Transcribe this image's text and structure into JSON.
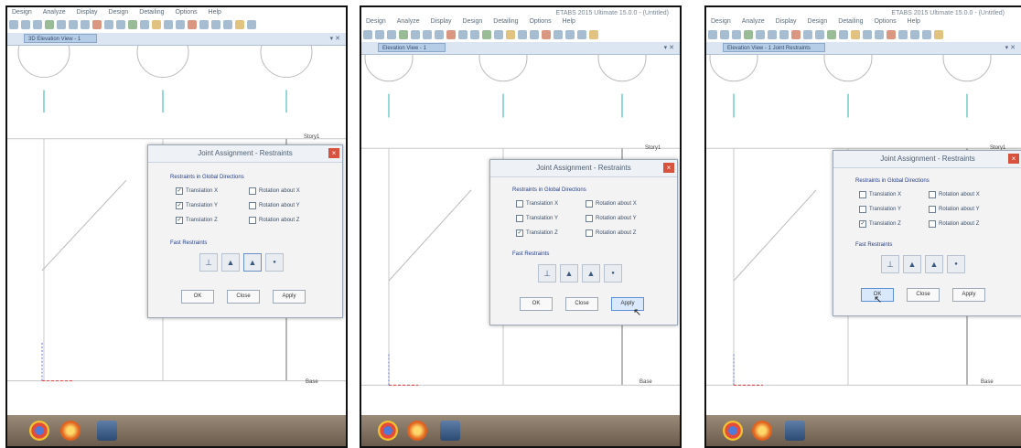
{
  "app": {
    "window_title": "ETABS 2015 Ultimate 15.0.0 - (Untitled)",
    "menu": [
      "Design",
      "Analyze",
      "Display",
      "Design",
      "Detailing",
      "Options",
      "Help"
    ],
    "tab_label_1": "3D Elevation View - 1",
    "tab_label_2": "Elevation View - 1",
    "tab_label_3": "Elevation View - 1 Joint Restraints",
    "story_top": "Story1",
    "story_base": "Base"
  },
  "dialog": {
    "title": "Joint Assignment - Restraints",
    "close_glyph": "×",
    "group_global": "Restraints in Global Directions",
    "group_fast": "Fast Restraints",
    "labels": {
      "ux": "Translation X",
      "uy": "Translation Y",
      "uz": "Translation Z",
      "rx": "Rotation about X",
      "ry": "Rotation about Y",
      "rz": "Rotation about Z"
    },
    "buttons": {
      "ok": "OK",
      "close": "Close",
      "apply": "Apply"
    },
    "fast_icons": {
      "none": "⊥",
      "pin": "▲",
      "fixed": "▲",
      "roller": "●"
    }
  },
  "frames": [
    {
      "checked": {
        "ux": true,
        "uy": true,
        "uz": true,
        "rx": false,
        "ry": false,
        "rz": false
      },
      "highlight": "none"
    },
    {
      "checked": {
        "ux": false,
        "uy": false,
        "uz": true,
        "rx": false,
        "ry": false,
        "rz": false
      },
      "highlight": "apply"
    },
    {
      "checked": {
        "ux": false,
        "uy": false,
        "uz": true,
        "rx": false,
        "ry": false,
        "rz": false
      },
      "highlight": "ok"
    }
  ],
  "colors": {
    "dialog_text": "#2d4f86",
    "close_red": "#d7533e",
    "grid_gray": "#c8c8c8",
    "taskbar_brown": "#7b6a58"
  },
  "taskbar_icons": [
    "chrome-icon",
    "firefox-icon",
    "etabs-icon"
  ]
}
